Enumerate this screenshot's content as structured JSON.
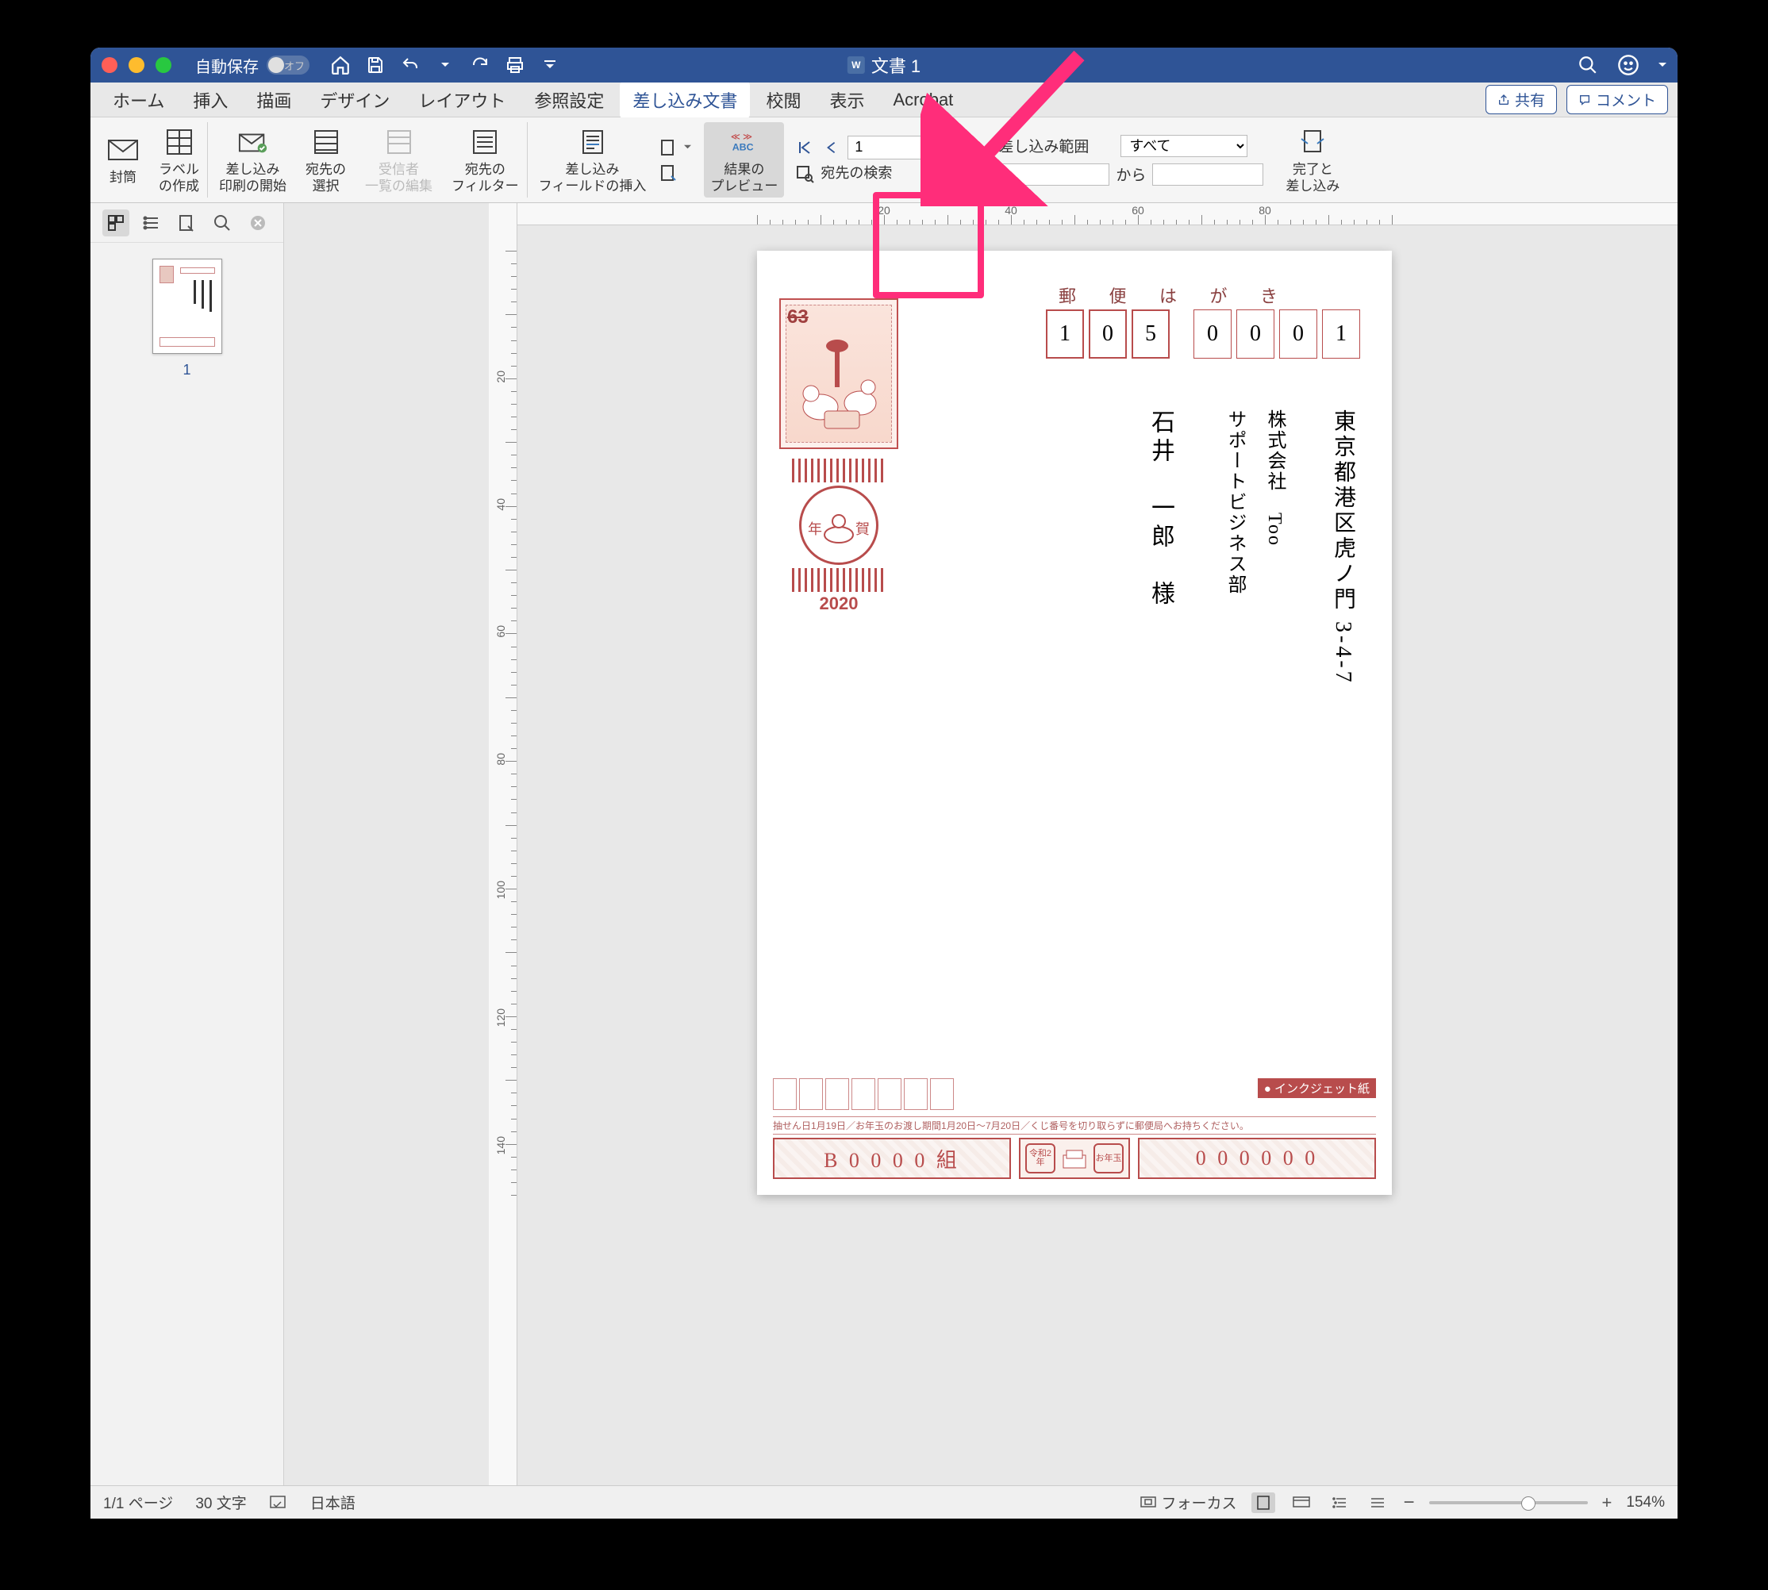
{
  "autosave_label": "自動保存",
  "autosave_state": "オフ",
  "document_title": "文書 1",
  "tabs": {
    "home": "ホーム",
    "insert": "挿入",
    "draw": "描画",
    "design": "デザイン",
    "layout": "レイアウト",
    "references": "参照設定",
    "mailings": "差し込み文書",
    "review": "校閲",
    "view": "表示",
    "acrobat": "Acrobat"
  },
  "share_label": "共有",
  "comment_label": "コメント",
  "ribbon": {
    "envelope": "封筒",
    "labels": "ラベル\nの作成",
    "start_merge": "差し込み\n印刷の開始",
    "select_recipients": "宛先の\n選択",
    "edit_recipients": "受信者\n一覧の編集",
    "filter": "宛先の\nフィルター",
    "insert_field": "差し込み\nフィールドの挿入",
    "preview": "結果の\nプレビュー",
    "find_recipient": "宛先の検索",
    "record_value": "1",
    "range_label": "差し込み範囲",
    "range_all": "すべて",
    "range_from": "から",
    "finish": "完了と\n差し込み"
  },
  "thumb_page": "1",
  "hruler_nums": [
    "20",
    "40",
    "60",
    "80"
  ],
  "vruler_nums": [
    "20",
    "40",
    "60",
    "80",
    "100",
    "120",
    "140"
  ],
  "postcard": {
    "top_label": "郵 便 は が き",
    "zip3": [
      "1",
      "0",
      "5"
    ],
    "zip4": [
      "0",
      "0",
      "0",
      "1"
    ],
    "stamp_value": "63",
    "nenga_left": "年",
    "nenga_right": "賀",
    "nenga_year": "2020",
    "address": "東京都港区虎ノ門 3-4-7",
    "company": "株式会社　Too",
    "department": "サポートビジネス部",
    "recipient": "石井　一郎　様",
    "inkjet": "インクジェット紙",
    "lottery_note": "抽せん日1月19日／お年玉のお渡し期間1月20日〜7月20日／くじ番号を切り取らずに郵便局へお持ちください。",
    "lottery_left": "B 0 0 0 0 組",
    "lottery_mid1": "令和2年",
    "lottery_mid2": "お年玉",
    "lottery_right": "0 0 0 0 0 0"
  },
  "status": {
    "page": "1/1 ページ",
    "chars": "30 文字",
    "lang": "日本語",
    "focus": "フォーカス",
    "zoom": "154%"
  }
}
